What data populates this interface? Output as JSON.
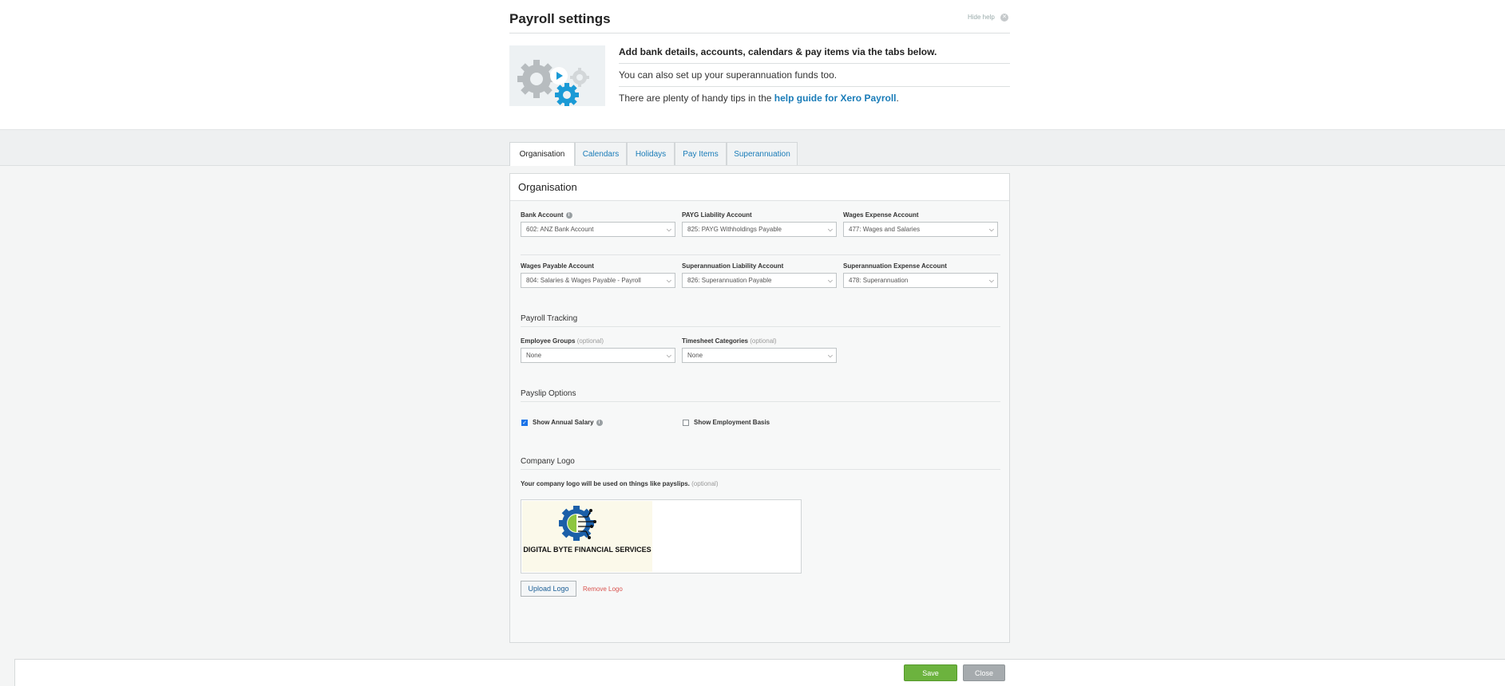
{
  "header": {
    "title": "Payroll settings",
    "hide_help": "Hide help",
    "help_line1": "Add bank details, accounts, calendars & pay items via the tabs below.",
    "help_line2": "You can also set up your superannuation funds too.",
    "help_line3_prefix": "There are plenty of handy tips in the",
    "help_link": "help guide for Xero Payroll",
    "help_line3_suffix": "."
  },
  "tabs": [
    {
      "label": "Organisation",
      "active": true
    },
    {
      "label": "Calendars",
      "active": false
    },
    {
      "label": "Holidays",
      "active": false
    },
    {
      "label": "Pay Items",
      "active": false
    },
    {
      "label": "Superannuation",
      "active": false
    }
  ],
  "panel": {
    "title": "Organisation",
    "accounts": [
      {
        "label": "Bank Account",
        "value": "602: ANZ Bank Account"
      },
      {
        "label": "PAYG Liability Account",
        "value": "825: PAYG Withholdings Payable"
      },
      {
        "label": "Wages Expense Account",
        "value": "477: Wages and Salaries"
      },
      {
        "label": "Wages Payable Account",
        "value": "804: Salaries & Wages Payable - Payroll"
      },
      {
        "label": "Superannuation Liability Account",
        "value": "826: Superannuation Payable"
      },
      {
        "label": "Superannuation Expense Account",
        "value": "478: Superannuation"
      }
    ],
    "tracking": {
      "heading": "Payroll Tracking",
      "employee_groups_label": "Employee Groups",
      "employee_groups_value": "None",
      "timesheet_label": "Timesheet Categories",
      "timesheet_value": "None",
      "optional": "(optional)"
    },
    "payslip": {
      "heading": "Payslip Options",
      "show_annual_salary": "Show Annual Salary",
      "show_annual_salary_checked": true,
      "show_employment_basis": "Show Employment Basis",
      "show_employment_basis_checked": false
    },
    "logo": {
      "heading": "Company Logo",
      "description": "Your company logo will be used on things like payslips.",
      "optional": "(optional)",
      "logo_text": "DIGITAL BYTE FINANCIAL SERVICES",
      "upload_label": "Upload Logo",
      "remove_label": "Remove Logo"
    }
  },
  "footer": {
    "save_label": "Save",
    "close_label": "Close"
  },
  "colors": {
    "link": "#1a7cb8",
    "save": "#6cb33e",
    "close": "#a6abae",
    "remove": "#d9534f"
  }
}
